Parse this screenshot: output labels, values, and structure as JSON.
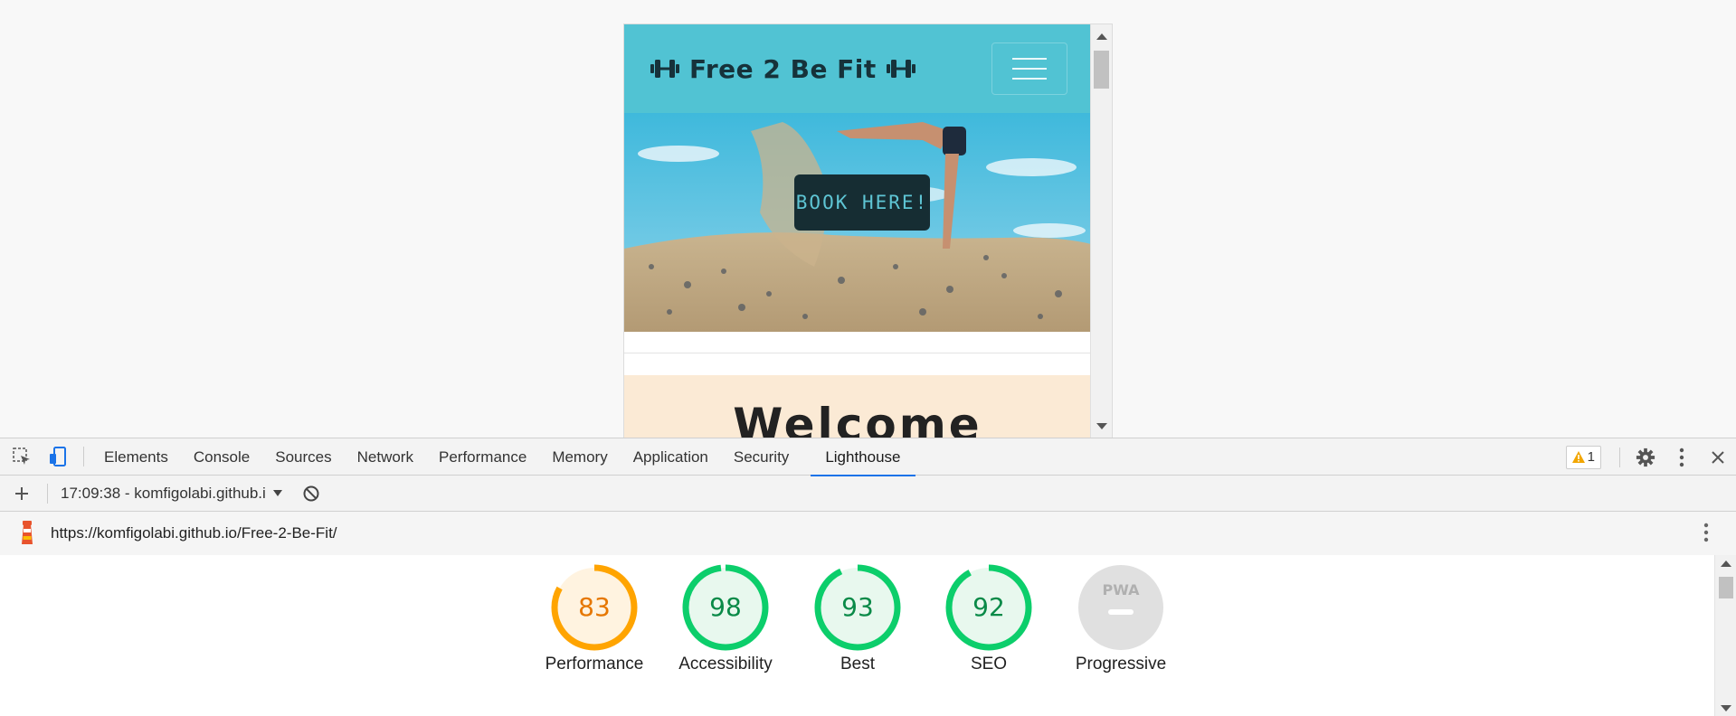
{
  "site": {
    "brand": "Free 2 Be Fit",
    "book_button": "BOOK HERE!",
    "welcome_title": "Welcome"
  },
  "devtools": {
    "tabs": [
      {
        "label": "Elements"
      },
      {
        "label": "Console"
      },
      {
        "label": "Sources"
      },
      {
        "label": "Network"
      },
      {
        "label": "Performance"
      },
      {
        "label": "Memory"
      },
      {
        "label": "Application"
      },
      {
        "label": "Security"
      },
      {
        "label": "Lighthouse",
        "active": true
      }
    ],
    "warning_count": "1",
    "report_select": "17:09:38 - komfigolabi.github.i",
    "report_url": "https://komfigolabi.github.io/Free-2-Be-Fit/"
  },
  "scores": [
    {
      "value": "83",
      "fraction": 0.83,
      "label": "Performance",
      "color": "#ffa400",
      "bg": "#fff3e0"
    },
    {
      "value": "98",
      "fraction": 0.98,
      "label": "Accessibility",
      "color": "#0cce6b",
      "bg": "#e8f8ee"
    },
    {
      "value": "93",
      "fraction": 0.93,
      "label": "Best",
      "color": "#0cce6b",
      "bg": "#e8f8ee"
    },
    {
      "value": "92",
      "fraction": 0.92,
      "label": "SEO",
      "color": "#0cce6b",
      "bg": "#e8f8ee"
    },
    {
      "value": "PWA",
      "fraction": 0,
      "label": "Progressive",
      "color": "#bdbdbd",
      "bg": "#e0e0e0"
    }
  ],
  "colors": {
    "nav_bg": "#51c3d3",
    "accent_blue": "#1a73e8",
    "lighthouse_orange": "#e8532c"
  }
}
